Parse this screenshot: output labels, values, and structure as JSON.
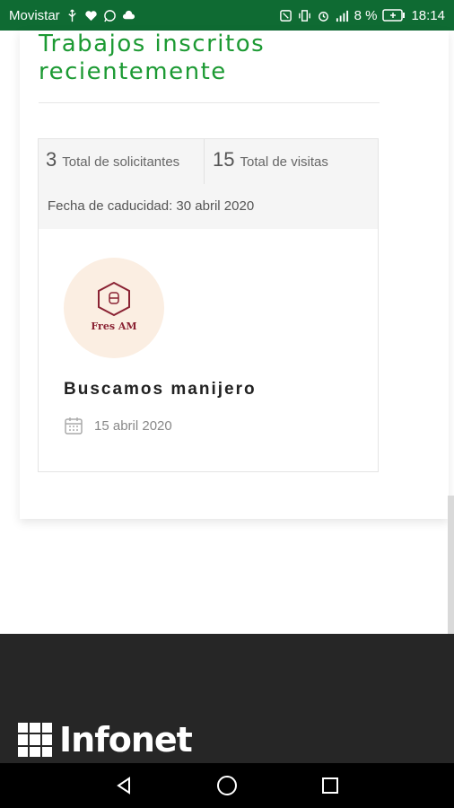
{
  "status_bar": {
    "carrier": "Movistar",
    "battery": "8 %",
    "time": "18:14",
    "icons_left": [
      "usb-icon",
      "heart-icon",
      "whatsapp-icon",
      "cloud-icon"
    ],
    "icons_right": [
      "nfc-icon",
      "vibrate-icon",
      "alarm-icon",
      "signal-icon",
      "battery-icon"
    ]
  },
  "section": {
    "title": "Trabajos inscritos recientemente"
  },
  "job": {
    "applicants_count": "3",
    "applicants_label": "Total de solicitantes",
    "visits_count": "15",
    "visits_label": "Total de visitas",
    "expiry": "Fecha de caducidad: 30 abril 2020",
    "company_logo_text": "Fres AM",
    "title": "Buscamos manijero",
    "date": "15 abril 2020"
  },
  "footer": {
    "brand": "Infonet"
  },
  "colors": {
    "status_bar": "#0f6b33",
    "accent_green": "#1c9a33",
    "logo_bg": "#fbeee2",
    "logo_brand": "#8a2233",
    "footer_bg": "#262626"
  }
}
